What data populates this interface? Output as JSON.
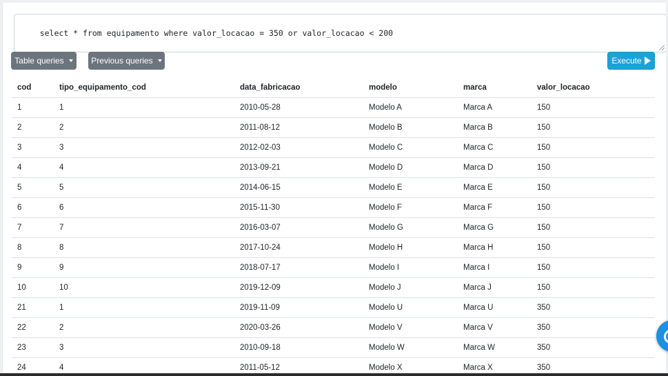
{
  "query": {
    "text": "select * from equipamento where valor_locacao = 350 or valor_locacao < 200"
  },
  "toolbar": {
    "table_queries_label": "Table queries",
    "previous_queries_label": "Previous queries",
    "execute_label": "Execute"
  },
  "colors": {
    "gray_button": "#6c757d",
    "execute_button": "#1aa3d9"
  },
  "icons": [
    "chevron-down-icon",
    "play-icon",
    "help-bubble-icon"
  ],
  "results": {
    "columns": [
      "cod",
      "tipo_equipamento_cod",
      "data_fabricacao",
      "modelo",
      "marca",
      "valor_locacao"
    ],
    "rows": [
      [
        "1",
        "1",
        "2010-05-28",
        "Modelo A",
        "Marca A",
        "150"
      ],
      [
        "2",
        "2",
        "2011-08-12",
        "Modelo B",
        "Marca B",
        "150"
      ],
      [
        "3",
        "3",
        "2012-02-03",
        "Modelo C",
        "Marca C",
        "150"
      ],
      [
        "4",
        "4",
        "2013-09-21",
        "Modelo D",
        "Marca D",
        "150"
      ],
      [
        "5",
        "5",
        "2014-06-15",
        "Modelo E",
        "Marca E",
        "150"
      ],
      [
        "6",
        "6",
        "2015-11-30",
        "Modelo F",
        "Marca F",
        "150"
      ],
      [
        "7",
        "7",
        "2016-03-07",
        "Modelo G",
        "Marca G",
        "150"
      ],
      [
        "8",
        "8",
        "2017-10-24",
        "Modelo H",
        "Marca H",
        "150"
      ],
      [
        "9",
        "9",
        "2018-07-17",
        "Modelo I",
        "Marca I",
        "150"
      ],
      [
        "10",
        "10",
        "2019-12-09",
        "Modelo J",
        "Marca J",
        "150"
      ],
      [
        "21",
        "1",
        "2019-11-09",
        "Modelo U",
        "Marca U",
        "350"
      ],
      [
        "22",
        "2",
        "2020-03-26",
        "Modelo V",
        "Marca V",
        "350"
      ],
      [
        "23",
        "3",
        "2010-09-18",
        "Modelo W",
        "Marca W",
        "350"
      ],
      [
        "24",
        "4",
        "2011-05-12",
        "Modelo X",
        "Marca X",
        "350"
      ]
    ]
  }
}
